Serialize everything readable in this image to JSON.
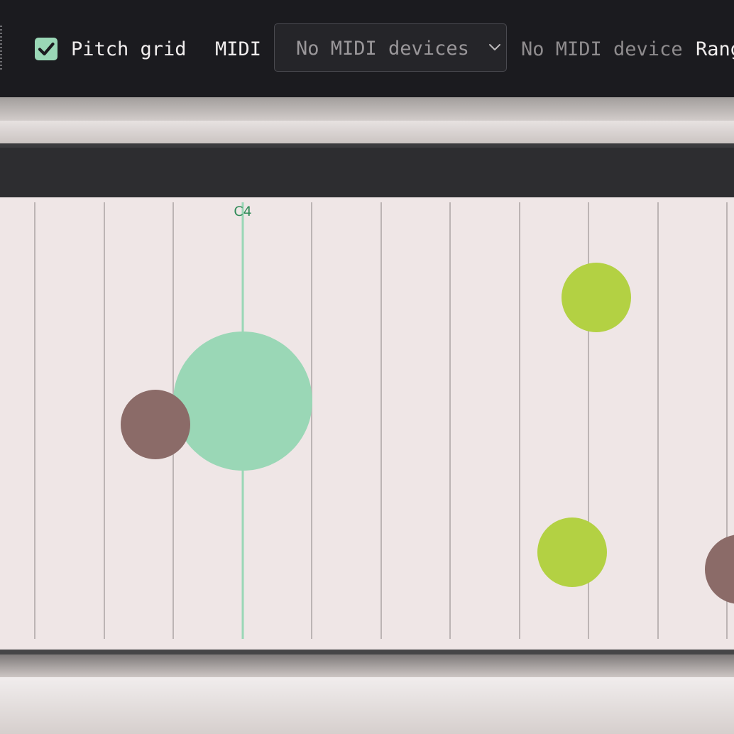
{
  "toolbar": {
    "pitch_grid_label": "Pitch grid",
    "pitch_grid_checked": true,
    "midi_label": "MIDI",
    "midi_select_value": "No MIDI devices",
    "midi_status": "No MIDI device",
    "range_label": "Rang"
  },
  "pitch_grid": {
    "c4_label": "C4",
    "colors": {
      "grid_line": "#bcb4b4",
      "c4_line": "#9ad7b6",
      "c4_text": "#2f8a57",
      "background": "#efe6e6"
    }
  },
  "voices": [
    {
      "name": "mint",
      "color": "#9ad7b6"
    },
    {
      "name": "brown",
      "color": "#8b6b68"
    },
    {
      "name": "lime",
      "color": "#b3d143"
    }
  ],
  "icons": {
    "checkbox": "check-icon",
    "select": "chevron-down-icon"
  }
}
